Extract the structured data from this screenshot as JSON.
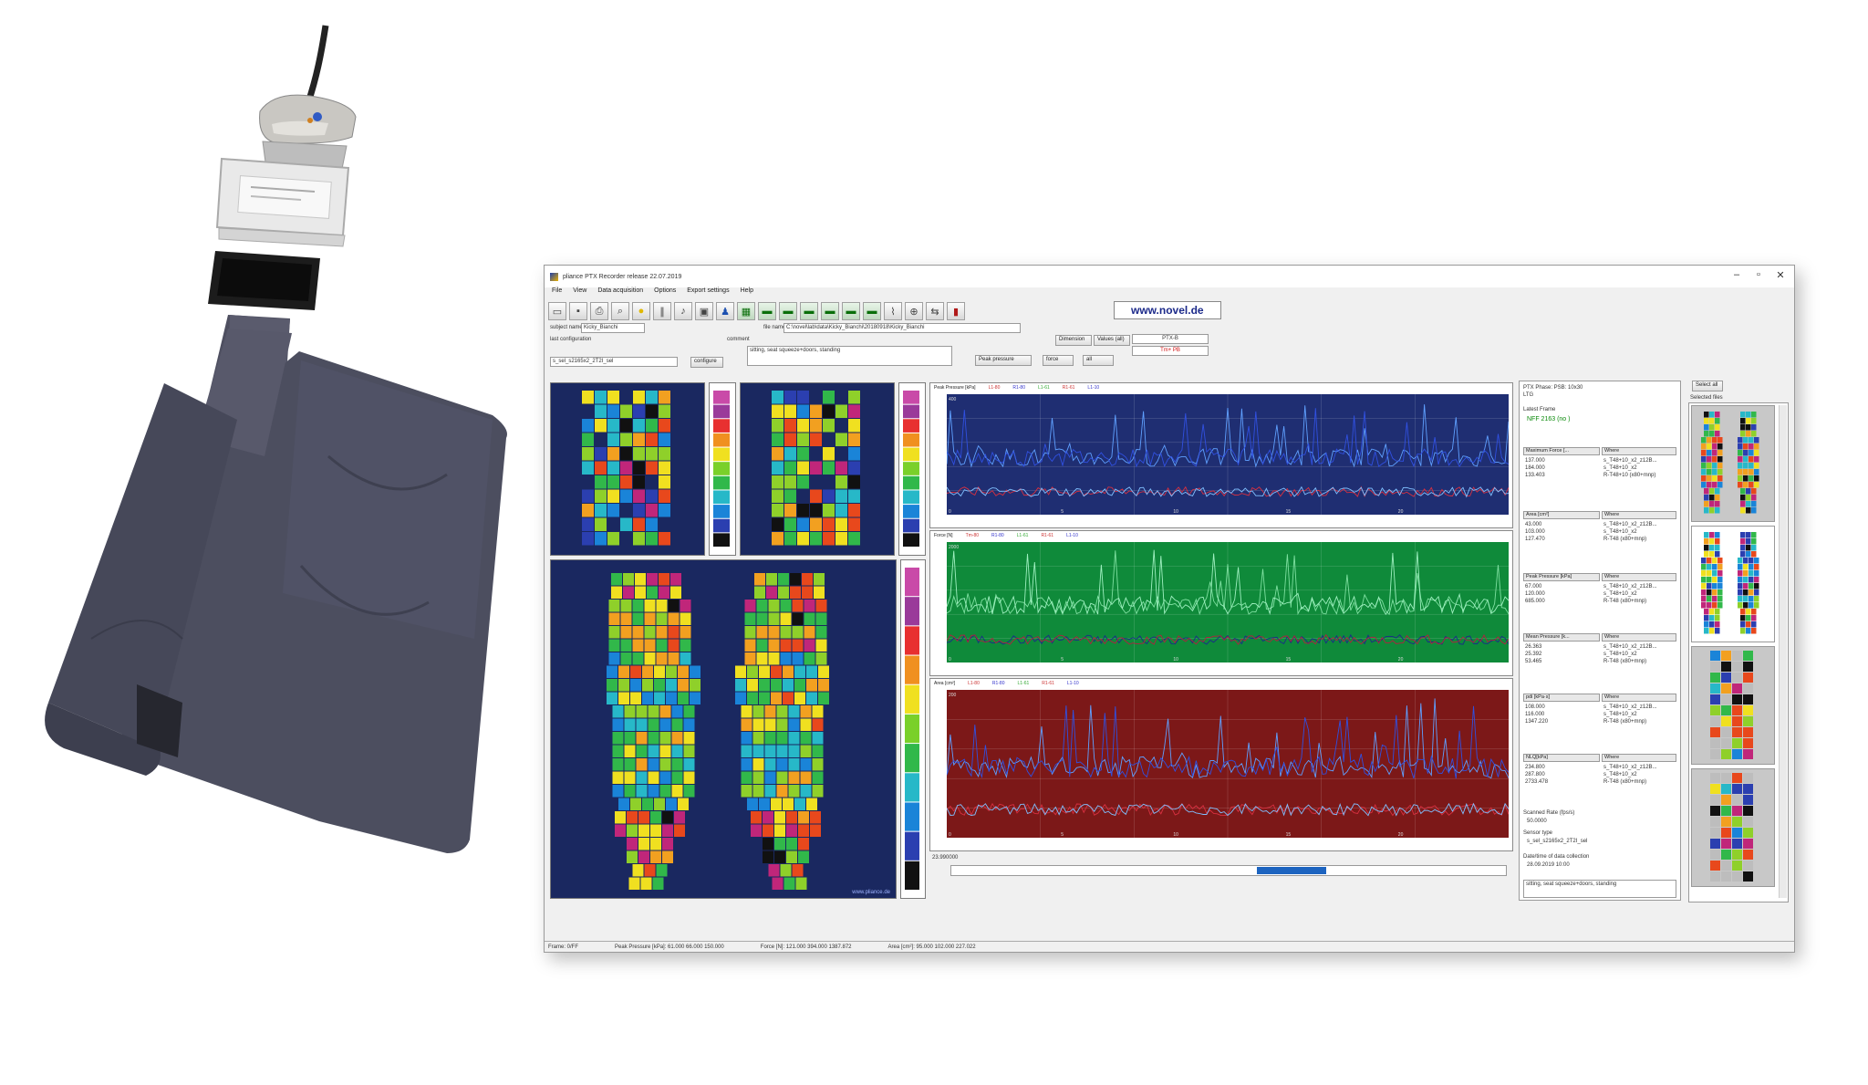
{
  "window": {
    "title": "pliance PTX Recorder release 22.07.2019",
    "minimize": "–",
    "maximize": "▫",
    "close": "✕"
  },
  "menu": [
    "File",
    "View",
    "Data acquisition",
    "Options",
    "Export settings",
    "Help"
  ],
  "toolbar": {
    "icons": [
      "open-folder-icon",
      "save-icon",
      "printer-icon",
      "print-preview-icon",
      "record-icon",
      "pause-icon",
      "bell-icon",
      "devices-icon",
      "network-icon",
      "grid-icon",
      "sensor-1-icon",
      "sensor-2-icon",
      "sensor-3-icon",
      "sensor-4-icon",
      "sensor-5-icon",
      "sensor-6-icon",
      "chart-icon",
      "zoom-icon",
      "arrows-icon",
      "battery-icon"
    ],
    "brand": "www.novel.de"
  },
  "form": {
    "subject_label": "subject name",
    "subject_value": "Kicky_Bianchi",
    "file_label": "file name",
    "file_value": "C:\\novel\\lab\\data\\Kicky_Bianchi\\20180918\\Kicky_Bianchi",
    "config_label": "last configuration",
    "config_value": "s_sel_s2165x2_2T2I_sel",
    "comment_label": "comment",
    "comment_value": "sitting, seat squeeze+doors, standing",
    "config_button": "configure",
    "dimension_button": "Dimension",
    "values_button": "Values (all)",
    "peak_label": "PTX-B",
    "peak_value": "Tm+ PB",
    "peak_pressure_toggle": "Peak pressure",
    "force_toggle": "force",
    "both_toggle": "all"
  },
  "charts": [
    {
      "title": "Peak Pressure [kPa]",
      "legend": [
        "L1-80",
        "R1-80",
        "L1-61",
        "R1-61",
        "L1-10",
        "R1-10",
        "L1-07"
      ],
      "bg": "#1f2e72",
      "ticks": [
        "0",
        "5",
        "10",
        "15",
        "20",
        "25"
      ],
      "ymax": "400"
    },
    {
      "title": "Force [N]",
      "legend": [
        "Tm-80",
        "R1-80",
        "L1-61",
        "R1-61",
        "L1-10",
        "R1-10",
        "L1-07"
      ],
      "bg": "#0f8a3a",
      "ticks": [
        "0",
        "5",
        "10",
        "15",
        "20",
        "25"
      ],
      "ymax": "2000"
    },
    {
      "title": "Area [cm²]",
      "legend": [
        "L1-80",
        "R1-80",
        "L1-61",
        "R1-61",
        "L1-10",
        "R1-10",
        "L1-07"
      ],
      "bg": "#7c1818",
      "ticks": [
        "0",
        "5",
        "10",
        "15",
        "20",
        "25"
      ],
      "ymax": "200"
    }
  ],
  "time_readout": "23.990000",
  "side": {
    "header": "PTX Phase: PSB: 10x30",
    "sub": "LTG",
    "label_latest": "Latest Frame",
    "latest_value": "NFF 2163 (no )",
    "table1_header": [
      "Maximum Force [...",
      "Where"
    ],
    "table1_rows": [
      [
        "137.000",
        "s_T48+10_x2_z12B..."
      ],
      [
        "184.000",
        "s_T48+10_x2"
      ],
      [
        "133.403",
        "R-T48+10 (x80+mnp)"
      ]
    ],
    "table2_header": [
      "Area [cm²]",
      "Where"
    ],
    "table2_rows": [
      [
        "43.000",
        "s_T48+10_x2_z12B..."
      ],
      [
        "103.000",
        "s_T48+10_x2"
      ],
      [
        "127.470",
        "R-T48 (x80+mnp)"
      ]
    ],
    "table3_header": [
      "Peak Pressure [kPa]",
      "Where"
    ],
    "table3_rows": [
      [
        "67.000",
        "s_T48+10_x2_z12B..."
      ],
      [
        "120.000",
        "s_T48+10_x2"
      ],
      [
        "685.000",
        "R-T48 (x80+mnp)"
      ]
    ],
    "table4_header": [
      "Mean Pressure [k...",
      "Where"
    ],
    "table4_rows": [
      [
        "26.363",
        "s_T48+10_x2_z12B..."
      ],
      [
        "25.392",
        "s_T48+10_x2"
      ],
      [
        "53.465",
        "R-T48 (x80+mnp)"
      ]
    ],
    "table5_header": [
      "pdi [kPa·s]",
      "Where"
    ],
    "table5_rows": [
      [
        "108.000",
        "s_T48+10_x2_z12B..."
      ],
      [
        "116.000",
        "s_T48+10_x2"
      ],
      [
        "1347.220",
        "R-T48 (x80+mnp)"
      ]
    ],
    "table6_header": [
      "NLQ[kPa]",
      "Where"
    ],
    "table6_rows": [
      [
        "234.800",
        "s_T48+10_x2_z12B..."
      ],
      [
        "287.800",
        "s_T48+10_x2"
      ],
      [
        "2733.478",
        "R-T48 (x80+mnp)"
      ]
    ],
    "sensor_hz_label": "Scanned Rate (fps/s)",
    "sensor_hz_value": "50.0000",
    "sensor_type_label": "Sensor type",
    "sensor_type_value": "s_sel_s2165x2_2T2I_sel",
    "time_label": "Date/time of data collection",
    "time_value": "28.09.2019 10:00",
    "footer_comment": "sitting, seat squeeze+doors, standing"
  },
  "thumbs": {
    "select_all": "Select all",
    "thumb_label": "Selected files"
  },
  "status": {
    "frame": "Frame: 0/FF",
    "peak": "Peak Pressure [kPa]:  61.000   66.000   150.000",
    "force": "Force [N]:  121.000   394.000   1387.872",
    "area": "Area [cm²]:  95.000   102.000   227.022"
  },
  "heatmap_footer": "www.pliance.de",
  "colors": {
    "panel": "#1a2860",
    "peak_chart": "#1f2e72",
    "force_chart": "#0f8a3a",
    "area_chart": "#7c1818"
  }
}
